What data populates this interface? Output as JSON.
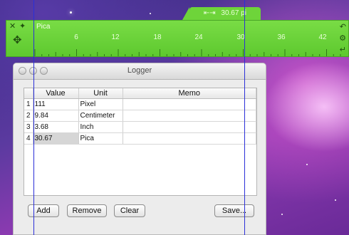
{
  "ruler": {
    "unit": "Pica",
    "measurement": "30.67 pi",
    "width_icon": "horizontal-arrows-icon",
    "ticks": [
      "6",
      "12",
      "18",
      "24",
      "30",
      "36",
      "42"
    ],
    "accent_color": "#6ed43a"
  },
  "logger": {
    "title": "Logger",
    "columns": [
      "",
      "Value",
      "Unit",
      "Memo"
    ],
    "rows": [
      {
        "index": "1",
        "value": "111",
        "unit": "Pixel",
        "memo": ""
      },
      {
        "index": "2",
        "value": "9.84",
        "unit": "Centimeter",
        "memo": ""
      },
      {
        "index": "3",
        "value": "3.68",
        "unit": "Inch",
        "memo": ""
      },
      {
        "index": "4",
        "value": "30.67",
        "unit": "Pica",
        "memo": ""
      }
    ],
    "buttons": {
      "add": "Add",
      "remove": "Remove",
      "clear": "Clear",
      "save": "Save..."
    }
  }
}
